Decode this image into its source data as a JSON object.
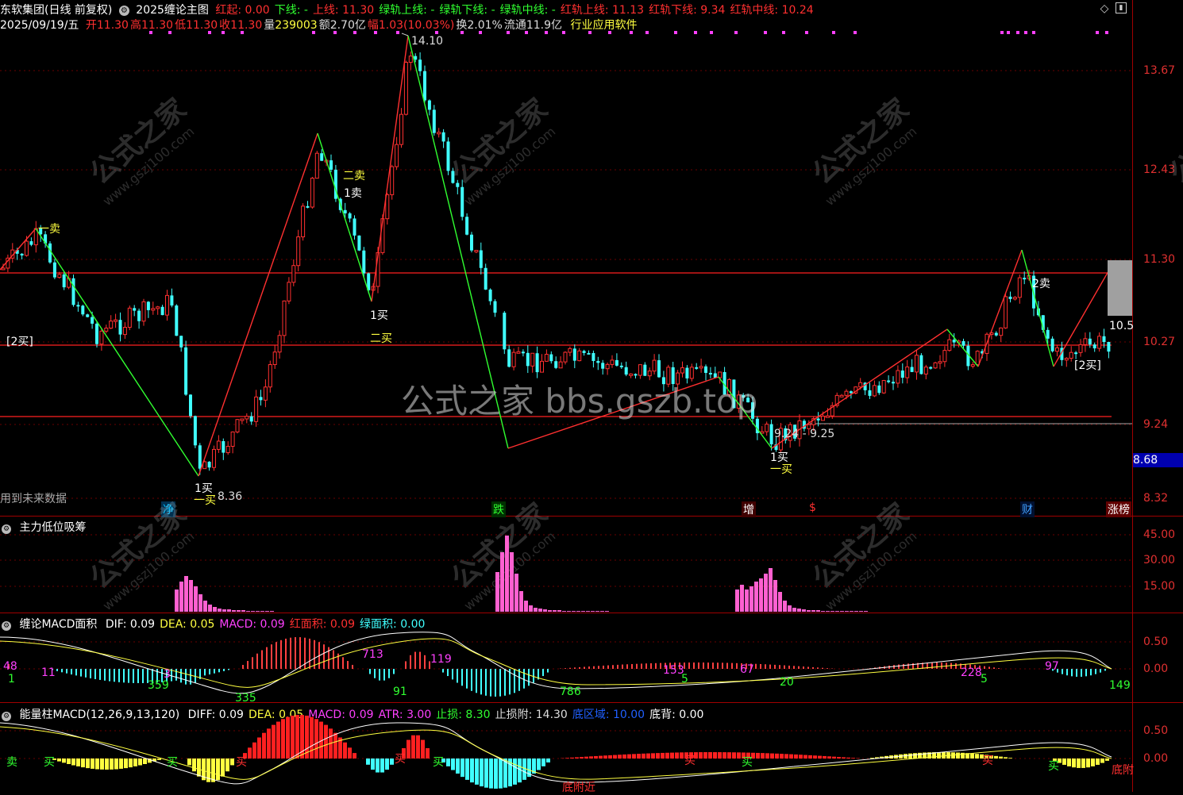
{
  "header": {
    "stock": "东软集团(日线 前复权)",
    "formula": "2025缠论主图",
    "items": [
      {
        "label": "红起: 0.00",
        "color": "#ff3030"
      },
      {
        "label": "下线: -",
        "color": "#30ff30"
      },
      {
        "label": "上线: 11.30",
        "color": "#ff3030"
      },
      {
        "label": "绿轨上线: -",
        "color": "#30ff30"
      },
      {
        "label": "绿轨下线: -",
        "color": "#30ff30"
      },
      {
        "label": "绿轨中线: -",
        "color": "#30ff30"
      },
      {
        "label": "红轨上线: 11.13",
        "color": "#ff3030"
      },
      {
        "label": "红轨下线: 9.34",
        "color": "#ff3030"
      },
      {
        "label": "红轨中线: 10.24",
        "color": "#ff3030"
      }
    ]
  },
  "infobar": {
    "date": "2025/09/19/五",
    "items": [
      {
        "label": "开",
        "value": "11.30",
        "color": "#ff3030"
      },
      {
        "label": "高",
        "value": "11.30",
        "color": "#ff3030"
      },
      {
        "label": "低",
        "value": "11.30",
        "color": "#ff3030"
      },
      {
        "label": "收",
        "value": "11.30",
        "color": "#ff3030"
      },
      {
        "label": "量",
        "value": "239003",
        "color": "#ffff40"
      },
      {
        "label": "额",
        "value": "2.70亿",
        "color": "#dddddd"
      },
      {
        "label": "幅",
        "value": "1.03(10.03%)",
        "color": "#ff3030"
      },
      {
        "label": "换",
        "value": "2.01%",
        "color": "#dddddd"
      },
      {
        "label": "流通",
        "value": "11.9亿",
        "color": "#dddddd"
      }
    ],
    "industry": "行业应用软件"
  },
  "main_axis": [
    "13.67",
    "12.43",
    "11.30",
    "10.27",
    "9.24",
    "8.32"
  ],
  "main_axis_highlight": "8.68",
  "main_labels": {
    "sell1_cn": "一卖",
    "buy2_left": "[2买]",
    "buy1_a": "1买",
    "buy1_a_cn": "一买",
    "low_a": "8.36",
    "sell2_cn": "二卖",
    "sell1_a": "1卖",
    "buy1_b": "1买",
    "buy2_cn": "二买",
    "high": "14.10",
    "range": "9.24 - 9.25",
    "buy1_c": "1买",
    "buy1_c_cn": "一买",
    "sell2_b": "2卖",
    "buy2_right": "[2买]",
    "price_tag": "10.5",
    "future_note": "用到未来数据"
  },
  "bottom_tags": [
    {
      "label": "净",
      "color": "#00c0ff",
      "bg": "#003050"
    },
    {
      "label": "跌",
      "color": "#30ff30",
      "bg": "#003000"
    },
    {
      "label": "增",
      "color": "#ffffff",
      "bg": "#400000"
    },
    {
      "label": "$",
      "color": "#ff3030",
      "bg": "#000000"
    },
    {
      "label": "财",
      "color": "#40a0ff",
      "bg": "#001030"
    },
    {
      "label": "涨榜",
      "color": "#ffffff",
      "bg": "#600000"
    }
  ],
  "panel1": {
    "title": "主力低位吸筹",
    "axis": [
      "45.00",
      "30.00",
      "15.00"
    ]
  },
  "panel2": {
    "title": "缠论MACD面积",
    "items": [
      {
        "label": "DIF: 0.09",
        "color": "#ffffff"
      },
      {
        "label": "DEA: 0.05",
        "color": "#ffff40"
      },
      {
        "label": "MACD: 0.09",
        "color": "#ff40ff"
      },
      {
        "label": "红面积: 0.09",
        "color": "#ff3030"
      },
      {
        "label": "绿面积: 0.00",
        "color": "#40ffff"
      }
    ],
    "axis": [
      "0.50",
      "0.00"
    ],
    "area_labels": [
      {
        "v": "48",
        "color": "#ff40ff"
      },
      {
        "v": "1",
        "color": "#30ff30"
      },
      {
        "v": "11",
        "color": "#ff40ff"
      },
      {
        "v": "359",
        "color": "#30ff30"
      },
      {
        "v": "3",
        "color": "#ff40ff"
      },
      {
        "v": "335",
        "color": "#30ff30"
      },
      {
        "v": "713",
        "color": "#ff40ff"
      },
      {
        "v": "91",
        "color": "#30ff30"
      },
      {
        "v": "119",
        "color": "#ff40ff"
      },
      {
        "v": "786",
        "color": "#30ff30"
      },
      {
        "v": "153",
        "color": "#ff40ff"
      },
      {
        "v": "5",
        "color": "#30ff30"
      },
      {
        "v": "67",
        "color": "#ff40ff"
      },
      {
        "v": "20",
        "color": "#30ff30"
      },
      {
        "v": "228",
        "color": "#ff40ff"
      },
      {
        "v": "5",
        "color": "#30ff30"
      },
      {
        "v": "97",
        "color": "#ff40ff"
      },
      {
        "v": "149",
        "color": "#30ff30"
      }
    ]
  },
  "panel3": {
    "title": "能量柱MACD(12,26,9,13,120)",
    "items": [
      {
        "label": "DIFF: 0.09",
        "color": "#ffffff"
      },
      {
        "label": "DEA: 0.05",
        "color": "#ffff40"
      },
      {
        "label": "MACD: 0.09",
        "color": "#ff40ff"
      },
      {
        "label": "ATR: 3.00",
        "color": "#ff40ff"
      },
      {
        "label": "止损: 8.30",
        "color": "#30ff30"
      },
      {
        "label": "止损附: 14.30",
        "color": "#dddddd"
      },
      {
        "label": "底区域: 10.00",
        "color": "#2060ff"
      },
      {
        "label": "底背: 0.00",
        "color": "#ffffff"
      }
    ],
    "axis": [
      "0.50",
      "0.00"
    ],
    "signals": [
      {
        "v": "卖",
        "color": "#30ff30"
      },
      {
        "v": "买",
        "color": "#30ff30"
      },
      {
        "v": "买",
        "color": "#30ff30"
      },
      {
        "v": "买",
        "color": "#ff3030"
      },
      {
        "v": "买",
        "color": "#ff3030"
      },
      {
        "v": "买",
        "color": "#30ff30"
      },
      {
        "v": "买",
        "color": "#ff3030"
      },
      {
        "v": "买",
        "color": "#30ff30"
      },
      {
        "v": "买",
        "color": "#ff3030"
      },
      {
        "v": "买",
        "color": "#30ff30"
      }
    ],
    "bottom_note1": "底附近",
    "bottom_note2": "底附"
  },
  "watermark": {
    "main": "公式之家 bbs.gszb.top",
    "tile_cn": "公式之家",
    "tile_url": "www.gszj100.com"
  }
}
